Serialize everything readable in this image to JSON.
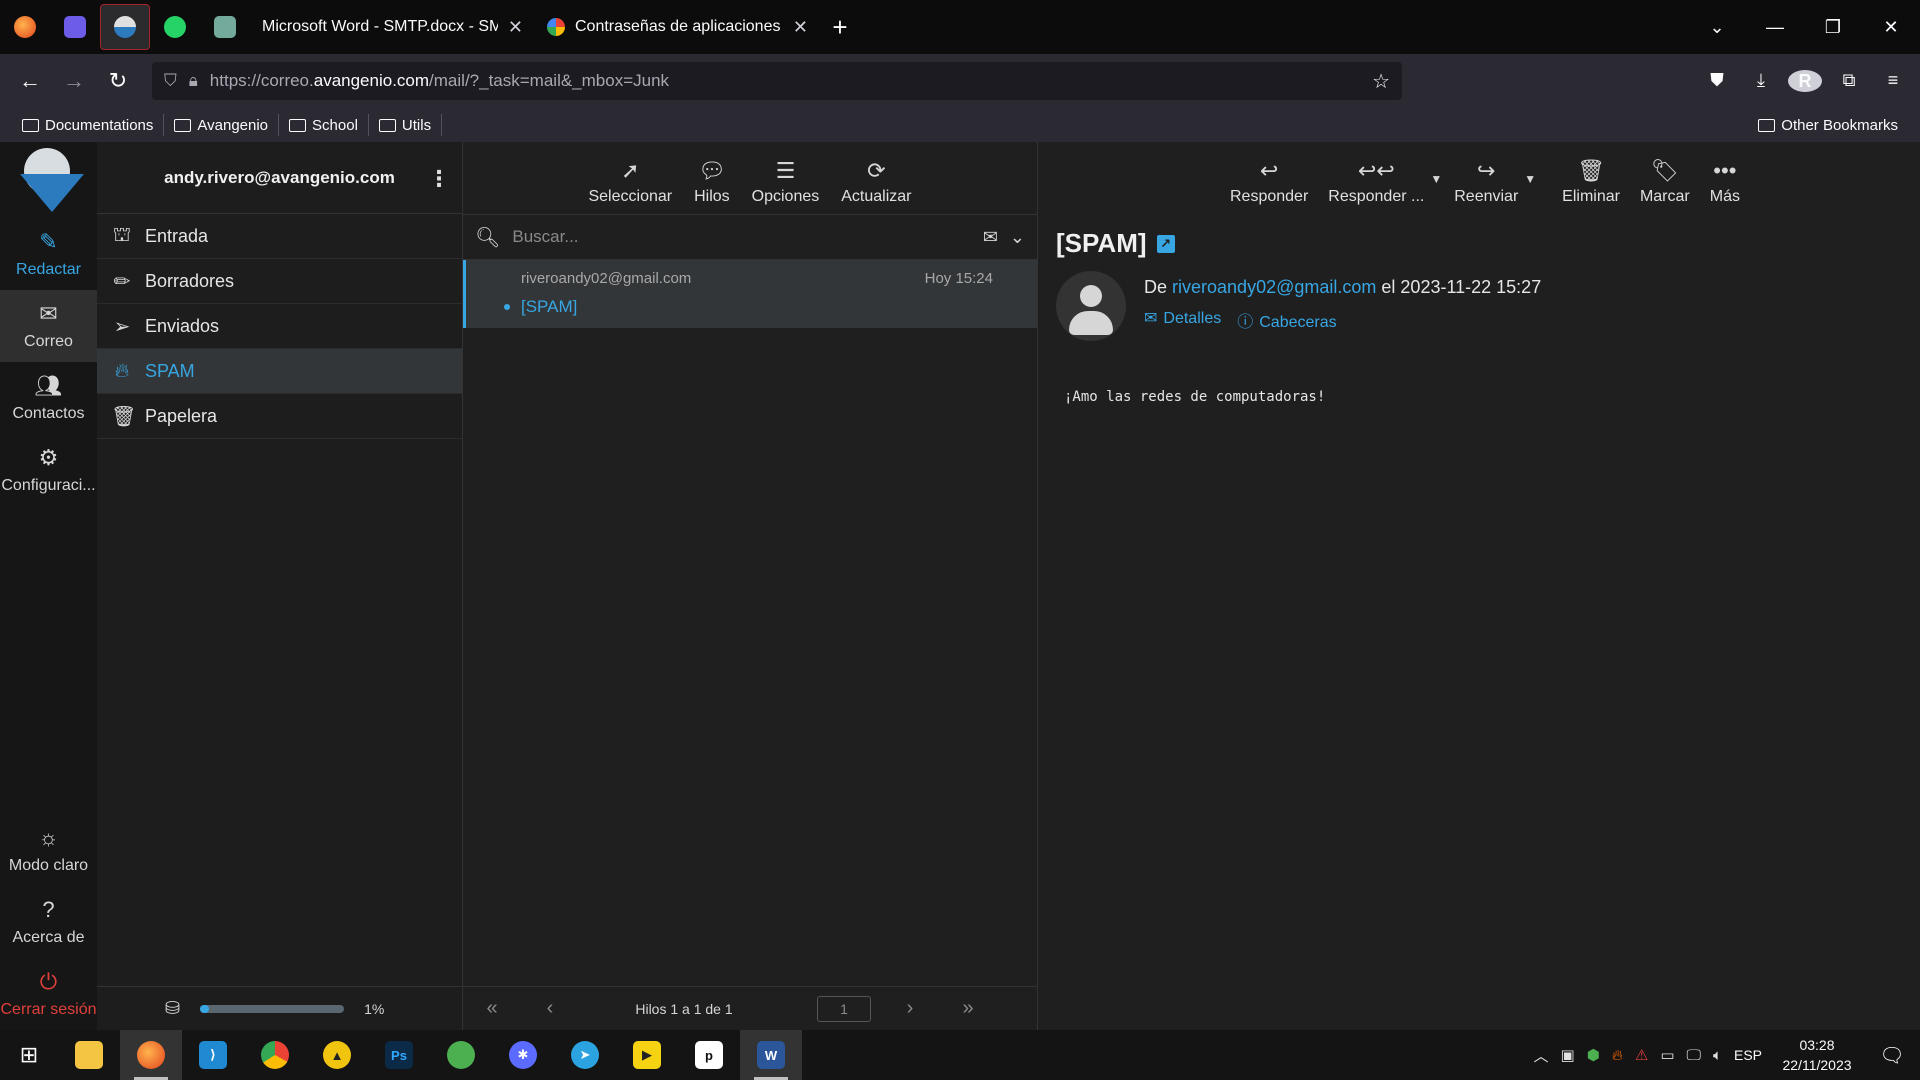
{
  "browser": {
    "tabs": [
      {
        "title": "Microsoft Word - SMTP.docx - SMTP",
        "close": "✕"
      },
      {
        "title": "Contraseñas de aplicaciones",
        "close": "✕"
      }
    ],
    "new_tab": "+",
    "url_prefix": "https://correo.",
    "url_host": "avangenio.com",
    "url_path": "/mail/?_task=mail&_mbox=Junk",
    "bookmarks": [
      "Documentations",
      "Avangenio",
      "School",
      "Utils"
    ],
    "other_bookmarks": "Other Bookmarks",
    "profile_letter": "R"
  },
  "rail": {
    "compose": "Redactar",
    "mail": "Correo",
    "contacts": "Contactos",
    "settings": "Configuraci...",
    "light_mode": "Modo claro",
    "about": "Acerca de",
    "logout": "Cerrar sesión"
  },
  "folders": {
    "account": "andy.rivero@avangenio.com",
    "items": [
      {
        "label": "Entrada",
        "icon": "inbox-icon"
      },
      {
        "label": "Borradores",
        "icon": "pencil-icon"
      },
      {
        "label": "Enviados",
        "icon": "paper-plane-icon"
      },
      {
        "label": "SPAM",
        "icon": "fire-icon"
      },
      {
        "label": "Papelera",
        "icon": "trash-icon"
      }
    ],
    "quota_percent": "1%",
    "quota_fraction": 0.06
  },
  "list": {
    "toolbar": [
      "Seleccionar",
      "Hilos",
      "Opciones",
      "Actualizar"
    ],
    "search_placeholder": "Buscar...",
    "message": {
      "from": "riveroandy02@gmail.com",
      "date": "Hoy 15:24",
      "subject": "[SPAM]"
    },
    "pager_info": "Hilos 1 a 1 de 1",
    "page": "1"
  },
  "reader": {
    "toolbar": [
      "Responder",
      "Responder ...",
      "Reenviar",
      "Eliminar",
      "Marcar",
      "Más"
    ],
    "subject": "[SPAM]",
    "from_prefix": "De",
    "from_email": "riveroandy02@gmail.com",
    "date_text": "el 2023-11-22 15:27",
    "details": "Detalles",
    "headers": "Cabeceras",
    "body": "¡Amo las redes de computadoras!"
  },
  "taskbar": {
    "lang": "ESP",
    "time": "03:28",
    "date": "22/11/2023"
  },
  "colors": {
    "accent": "#37a6e3",
    "danger": "#e0403b",
    "background": "#1c1c1c"
  }
}
